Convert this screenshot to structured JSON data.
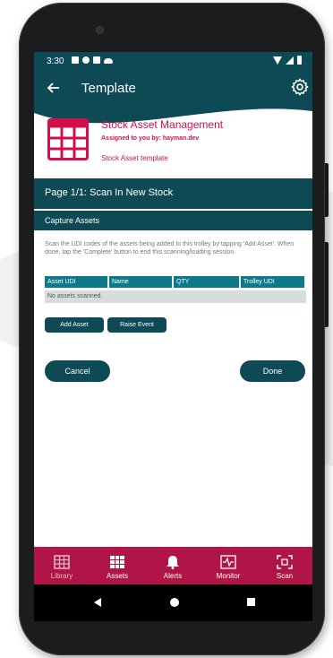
{
  "status_bar": {
    "time": "3:30"
  },
  "header": {
    "title": "Template",
    "app_title": "Stock Asset Management",
    "assigned": "Assigned to you by: hayman.dev",
    "template_name": "Stock Asset template"
  },
  "page_bar": {
    "label": "Page 1/1: Scan In New Stock"
  },
  "section": {
    "title": "Capture Assets",
    "instructions": "Scan the UDI codes of the assets being added to this trolley by tapping 'Add Asset'. When done, tap the 'Complete' button to end this scanning/loading session."
  },
  "table": {
    "columns": [
      "Asset UDI",
      "Name",
      "QTY",
      "Trolley UDI"
    ],
    "empty_message": "No assets scanned."
  },
  "actions": {
    "add_asset": "Add Asset",
    "raise_event": "Raise Event"
  },
  "footer_buttons": {
    "cancel": "Cancel",
    "done": "Done"
  },
  "bottom_nav": {
    "items": [
      {
        "label": "Library",
        "icon": "library-icon",
        "active": true
      },
      {
        "label": "Assets",
        "icon": "assets-grid-icon",
        "active": false
      },
      {
        "label": "Alerts",
        "icon": "bell-icon",
        "active": false
      },
      {
        "label": "Monitor",
        "icon": "monitor-icon",
        "active": false
      },
      {
        "label": "Scan",
        "icon": "scan-icon",
        "active": false
      }
    ]
  },
  "colors": {
    "primary": "#0d4a55",
    "accent": "#d0104c",
    "nav_bar": "#b01548",
    "table_header": "#0d7a8c"
  }
}
